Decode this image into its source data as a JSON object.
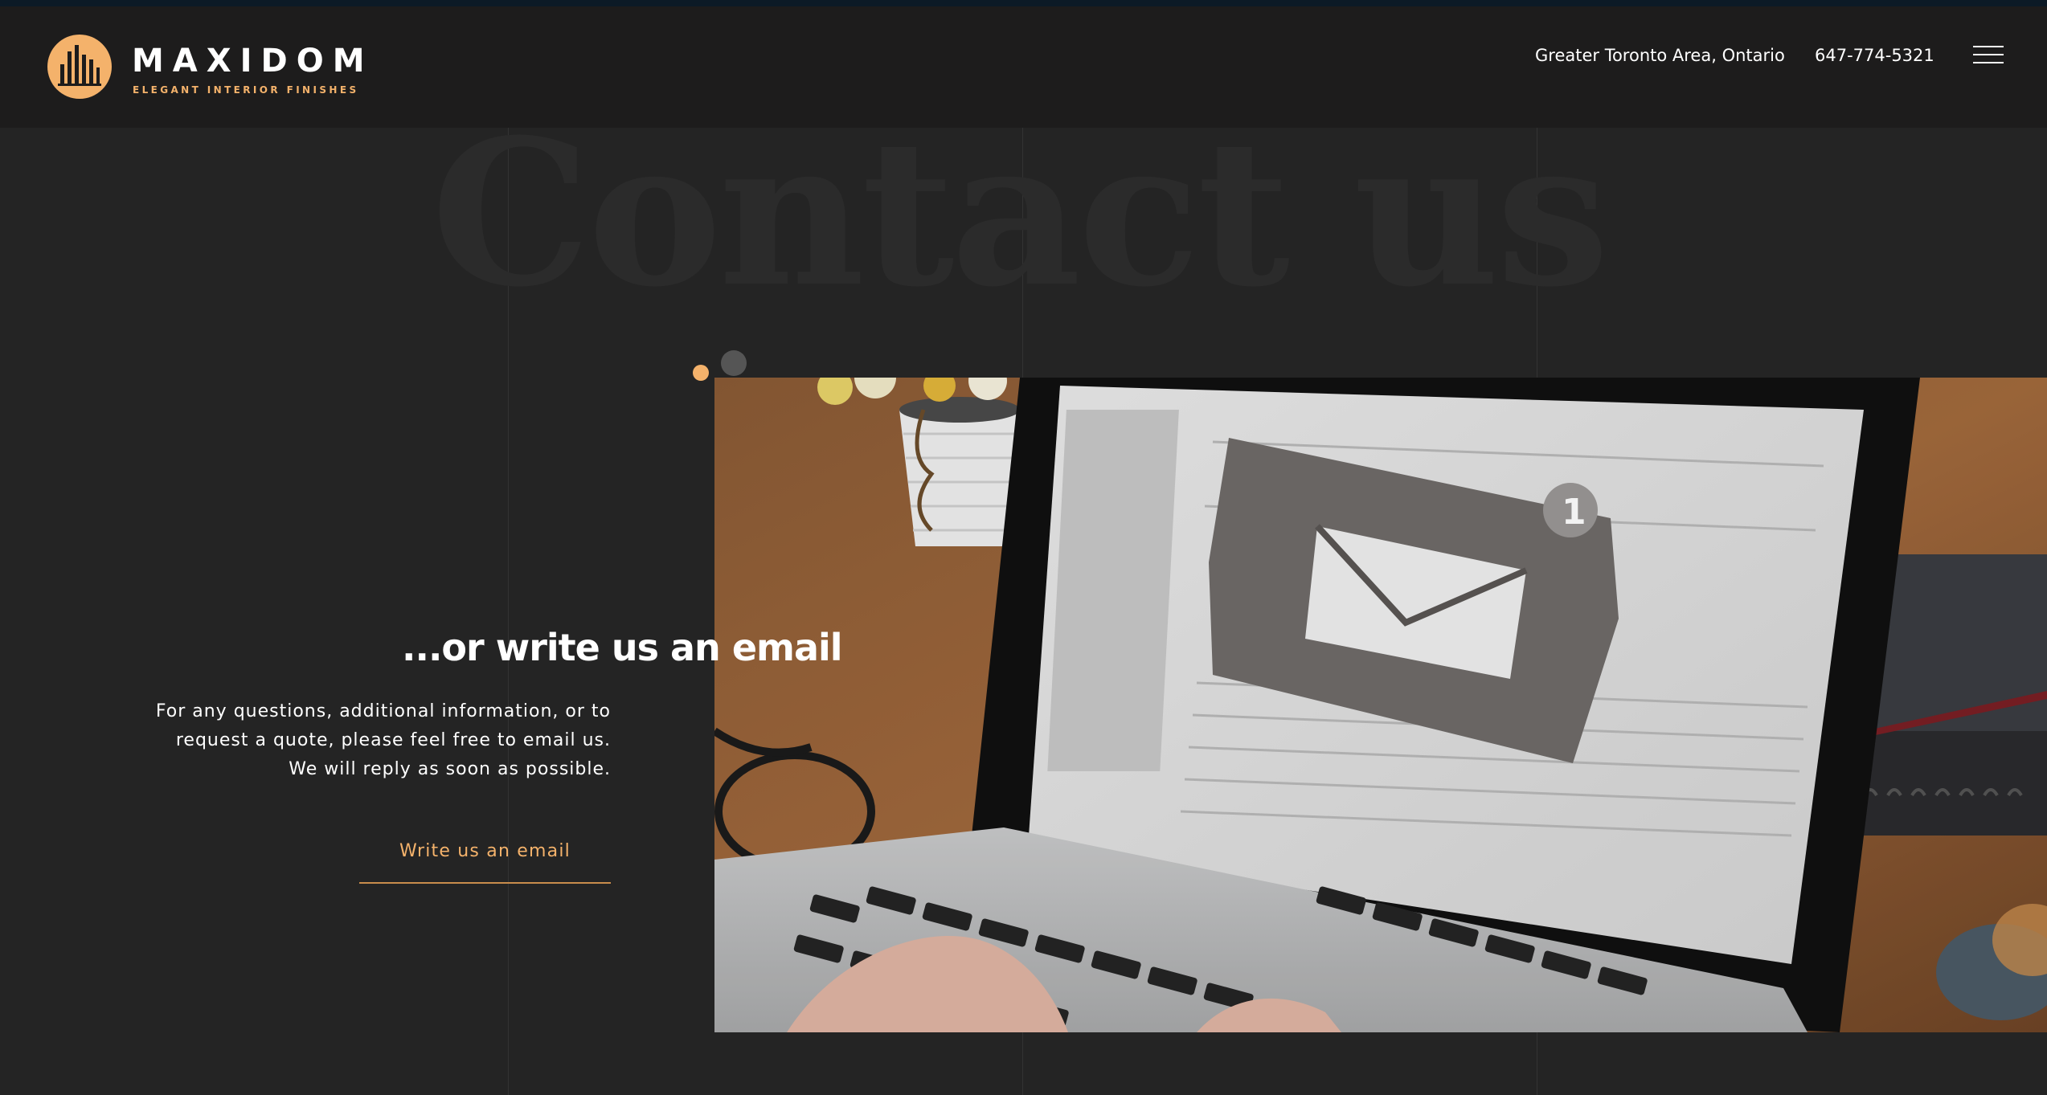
{
  "brand": {
    "name": "MAXIDOM",
    "tagline": "ELEGANT INTERIOR FINISHES",
    "accent_color": "#f4b26b",
    "logo_icon": "bar-chart-circle-icon"
  },
  "header": {
    "location": "Greater Toronto Area, Ontario",
    "phone": "647-774-5321",
    "menu_icon": "hamburger-menu-icon"
  },
  "hero": {
    "background_heading": "Contact us"
  },
  "slider": {
    "dots_count": 2,
    "active_index": 0
  },
  "email_section": {
    "title": "...or write us an email",
    "body_lines": [
      "For any questions, additional information, or to",
      "request a quote, please feel free to email us.",
      "We will reply as soon as possible."
    ],
    "cta_label": "Write us an email",
    "image_subject": "laptop-email-photo"
  }
}
